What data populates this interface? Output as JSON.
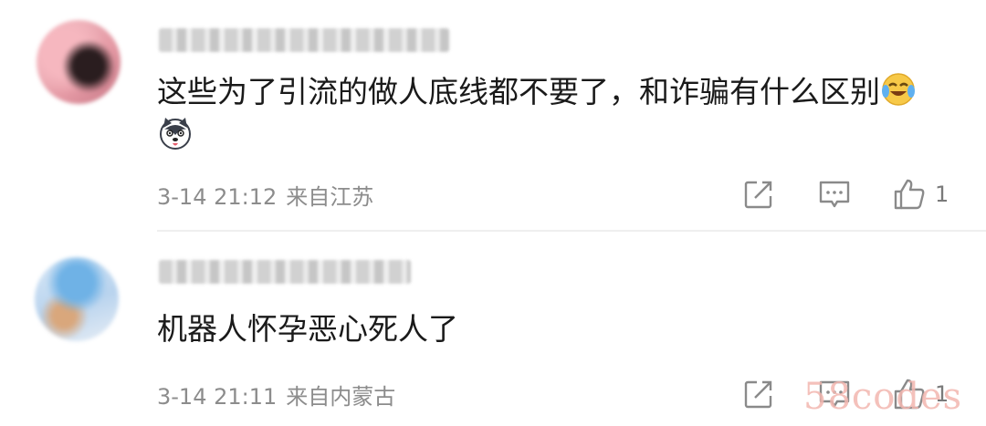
{
  "comments": [
    {
      "username": "",
      "text": "这些为了引流的做人底线都不要了，和诈骗有什么区别",
      "emojis": [
        "crying-laughing-emoji",
        "husky-emoji"
      ],
      "time": "3-14 21:12",
      "location": "来自江苏",
      "likes": "1"
    },
    {
      "username": "",
      "text": "机器人怀孕恶心死人了",
      "emojis": [],
      "time": "3-14 21:11",
      "location": "来自内蒙古",
      "likes": "1"
    }
  ],
  "watermark": "58codes",
  "colors": {
    "meta": "#8c8c8c",
    "text": "#1a1a1a",
    "icon": "#8a8a8a",
    "watermark": "#f3b7b0"
  }
}
